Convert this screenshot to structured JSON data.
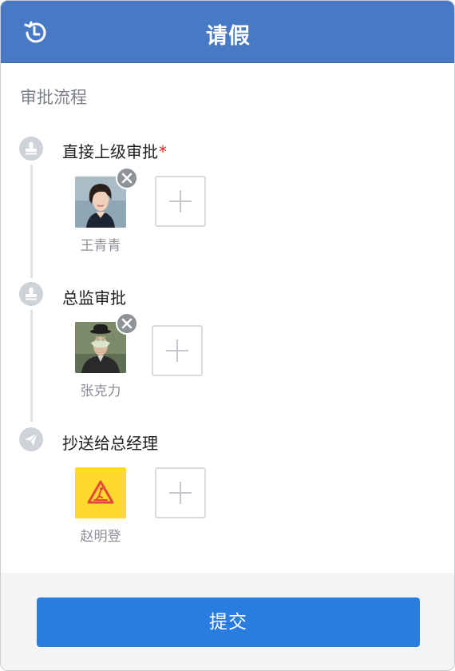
{
  "header": {
    "title": "请假",
    "history_icon": "history-icon",
    "color": "#4779c4"
  },
  "section_title": "审批流程",
  "steps": [
    {
      "label": "直接上级审批",
      "required_mark": "*",
      "icon": "stamp-icon",
      "people": [
        {
          "name": "王青青",
          "avatar": "avatar-photo-woman"
        }
      ]
    },
    {
      "label": "总监审批",
      "required_mark": "",
      "icon": "stamp-icon",
      "people": [
        {
          "name": "张克力",
          "avatar": "avatar-painting-man-bowler-hat"
        }
      ]
    },
    {
      "label": "抄送给总经理",
      "required_mark": "",
      "icon": "paper-plane-icon",
      "people": [
        {
          "name": "赵明登",
          "avatar": "avatar-caution-sign",
          "avatar_color": "#ffd92e"
        }
      ]
    }
  ],
  "submit_label": "提交",
  "accent": "#2a7de0"
}
